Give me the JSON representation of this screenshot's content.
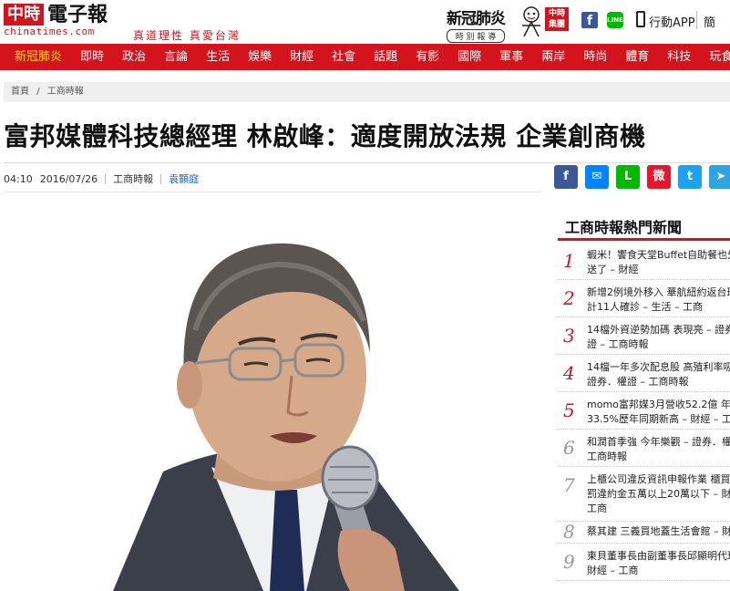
{
  "header": {
    "logo_mark": "中時",
    "logo_name": "電子報",
    "logo_url": "chinatimes.com",
    "slogan": "真道理性  真愛台灣",
    "covid_logo_title": "新冠肺炎",
    "covid_logo_sub": "時 別 報 導",
    "group_logo": "中時集團",
    "fb_glyph": "f",
    "line_glyph": "LINE",
    "app_label": "行動APP",
    "lang_label": "簡"
  },
  "nav": {
    "items": [
      "新冠肺炎",
      "即時",
      "政治",
      "言論",
      "生活",
      "娛樂",
      "財經",
      "社會",
      "話題",
      "有影",
      "國際",
      "軍事",
      "兩岸",
      "時尚",
      "體育",
      "科技",
      "玩食"
    ],
    "active_index": 0
  },
  "breadcrumb": {
    "home": "首頁",
    "separator": "/",
    "section": "工商時報"
  },
  "article": {
    "title": "富邦媒體科技總經理 林啟峰：適度開放法規 企業創商機",
    "time": "04:10",
    "date": "2016/07/26",
    "source": "工商時報",
    "author": "袁顥庭"
  },
  "share_buttons": [
    {
      "name": "facebook-share-icon",
      "glyph": "f",
      "color": "#3b5998"
    },
    {
      "name": "messenger-share-icon",
      "glyph": "✉",
      "color": "#0084ff"
    },
    {
      "name": "line-share-icon",
      "glyph": "L",
      "color": "#00b900"
    },
    {
      "name": "weibo-share-icon",
      "glyph": "微",
      "color": "#e6162d"
    },
    {
      "name": "twitter-share-icon",
      "glyph": "t",
      "color": "#1da1f2"
    },
    {
      "name": "telegram-share-icon",
      "glyph": "➤",
      "color": "#2ca5e0"
    }
  ],
  "sidebar": {
    "title": "工商時報熱門新聞",
    "items": [
      {
        "num": "1",
        "line1": "蝦米！饗食天堂Buffet自助餐也外",
        "line2": "送了 – 財經"
      },
      {
        "num": "2",
        "line1": "新增2例境外移入 華航紐約返台班",
        "line2": "計11人確診 – 生活 – 工商"
      },
      {
        "num": "3",
        "line1": "14檔外資逆勢加碼 表現亮 – 證券",
        "line2": "證 – 工商時報"
      },
      {
        "num": "4",
        "line1": "14檔一年多次配息股 高殖利率吸睛",
        "line2": "證券．權證 – 工商時報"
      },
      {
        "num": "5",
        "line1": "momo富邦媒3月營收52.2億 年增",
        "line2": "33.5%歷年同期新高 – 財經 – 工商"
      },
      {
        "num": "6",
        "line1": "和潤首季強 今年樂觀 – 證券．權",
        "line2": "工商時報"
      },
      {
        "num": "7",
        "line1": "上櫃公司違反資訊申報作業 櫃買中",
        "line2": "罰違約金五萬以上20萬以下 – 財經",
        "line3": "工商"
      },
      {
        "num": "8",
        "line1": "蔡其建 三義買地蓋生活會館 – 財"
      },
      {
        "num": "9",
        "line1": "東貝董事長由副董事長邱顯明代理",
        "line2": "財經 – 工商"
      }
    ]
  },
  "colors": {
    "brand_red": "#d3141d",
    "nav_active": "#ffe100"
  }
}
